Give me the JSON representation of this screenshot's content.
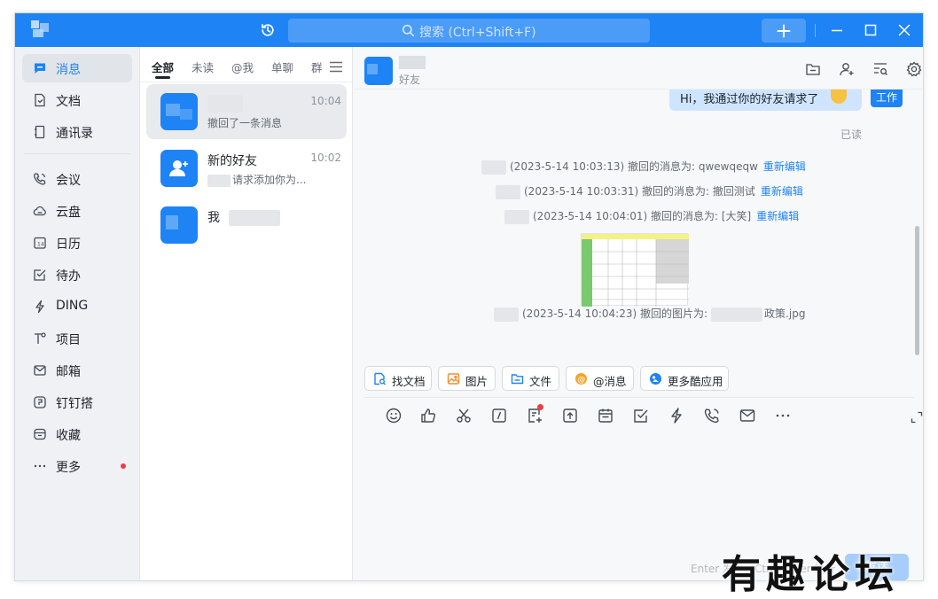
{
  "titlebar": {
    "search_placeholder": "搜索 (Ctrl+Shift+F)"
  },
  "nav": {
    "items": [
      {
        "label": "消息",
        "icon": "chat-icon",
        "active": true
      },
      {
        "label": "文档",
        "icon": "document-icon"
      },
      {
        "label": "通讯录",
        "icon": "contacts-icon"
      },
      {
        "label": "会议",
        "icon": "phone-meeting-icon"
      },
      {
        "label": "云盘",
        "icon": "cloud-icon"
      },
      {
        "label": "日历",
        "icon": "calendar-icon"
      },
      {
        "label": "待办",
        "icon": "todo-check-icon"
      },
      {
        "label": "DING",
        "icon": "ding-lightning-icon"
      },
      {
        "label": "项目",
        "icon": "project-icon"
      },
      {
        "label": "邮箱",
        "icon": "mail-icon"
      },
      {
        "label": "钉钉搭",
        "icon": "builder-icon"
      },
      {
        "label": "收藏",
        "icon": "favorites-icon"
      },
      {
        "label": "更多",
        "icon": "more-icon",
        "badge_dot": true
      }
    ]
  },
  "conversations": {
    "tabs": [
      "全部",
      "未读",
      "@我",
      "单聊",
      "群"
    ],
    "items": [
      {
        "name": "",
        "time": "10:04",
        "preview": "撤回了一条消息"
      },
      {
        "name": "新的好友",
        "time": "10:02",
        "preview": "请求添加你为..."
      },
      {
        "name": "我",
        "time": "",
        "preview": ""
      }
    ]
  },
  "chat": {
    "header_subtitle": "好友",
    "outgoing_message": "Hi，我通过你的好友请求了",
    "me_tag": "工作",
    "read_status": "已读",
    "system_messages": [
      {
        "text": "(2023-5-14 10:03:13) 撤回的消息为: qwewqeqw",
        "link": "重新编辑"
      },
      {
        "text": "(2023-5-14 10:03:31) 撤回的消息为: 撤回测试",
        "link": "重新编辑"
      },
      {
        "text": "(2023-5-14 10:04:01) 撤回的消息为: [大笑]",
        "link": "重新编辑"
      },
      {
        "text": "(2023-5-14 10:04:23) 撤回的图片为:",
        "suffix": "政策.jpg",
        "link": ""
      }
    ],
    "quick_actions": [
      "找文档",
      "图片",
      "文件",
      "@消息",
      "更多酷应用"
    ],
    "send_hint": "Enter 发送，Ctrl+Enter 换行",
    "send_label": "发送"
  },
  "watermark": "有趣论坛",
  "colors": {
    "accent": "#1e83f5",
    "titlebar": "#1e83f5",
    "link": "#1e83f5",
    "badge": "#f23d3d"
  }
}
